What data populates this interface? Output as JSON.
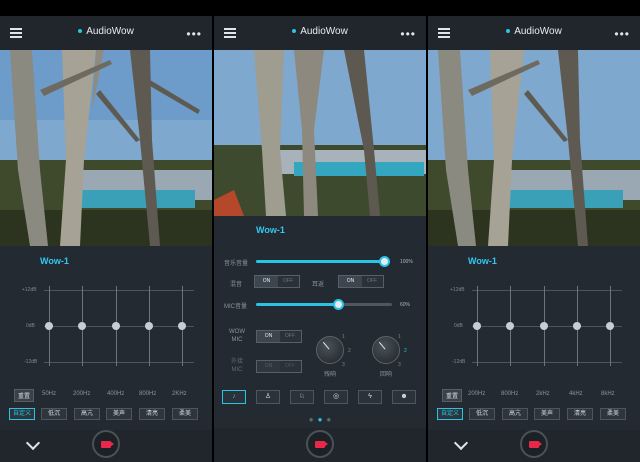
{
  "app": {
    "title": "AudioWow"
  },
  "panels": [
    {
      "device_name": "Wow-1",
      "eq": {
        "db_labels": [
          "+12dB",
          "0dB",
          "-12dB"
        ],
        "reset_label": "重置",
        "bands": [
          {
            "freq": "50Hz",
            "level": 0
          },
          {
            "freq": "200Hz",
            "level": 0
          },
          {
            "freq": "400Hz",
            "level": 0
          },
          {
            "freq": "800Hz",
            "level": 0
          },
          {
            "freq": "2KHz",
            "level": 0
          }
        ],
        "presets": [
          "自定义",
          "低沉",
          "高亢",
          "美声",
          "清亮",
          "柔美"
        ],
        "active_preset": 0
      }
    },
    {
      "device_name": "Wow-1",
      "mixer": {
        "music_volume_label": "音乐音量",
        "music_volume": 100,
        "music_volume_text": "100%",
        "mix_label": "混音",
        "monitor_label": "耳返",
        "mic_volume_label": "MIC音量",
        "mic_volume": 60,
        "mic_volume_text": "60%",
        "wow_mic_label": "WOW MIC",
        "mic_boost_label": "外接 MIC",
        "toggle_on": "ON",
        "toggle_off": "OFF",
        "reverb_label": "残响",
        "echo_label": "回响",
        "knob_scale": [
          "1",
          "2",
          "3",
          "1",
          "2",
          "3"
        ],
        "effects": [
          "music-note",
          "person-1",
          "person-2",
          "globe",
          "lightning",
          "creature"
        ]
      }
    },
    {
      "device_name": "Wow-1",
      "eq": {
        "db_labels": [
          "+12dB",
          "0dB",
          "-12dB"
        ],
        "reset_label": "重置",
        "bands": [
          {
            "freq": "200Hz",
            "level": 0
          },
          {
            "freq": "800Hz",
            "level": 0
          },
          {
            "freq": "2kHz",
            "level": 0
          },
          {
            "freq": "4kHz",
            "level": 0
          },
          {
            "freq": "8kHz",
            "level": 0
          }
        ],
        "presets": [
          "自定义",
          "低沉",
          "高亢",
          "美声",
          "清亮",
          "柔美"
        ],
        "active_preset": 0
      }
    }
  ],
  "colors": {
    "accent": "#29c3e6",
    "record": "#e8274a",
    "background": "#232a31"
  }
}
